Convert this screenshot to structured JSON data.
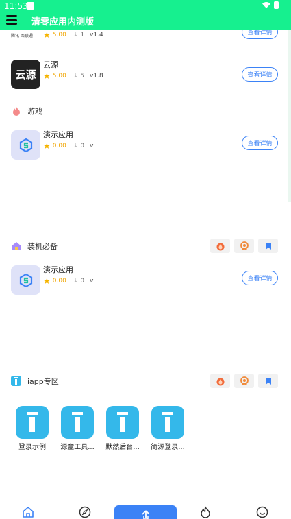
{
  "status": {
    "time": "11:53"
  },
  "header": {
    "title": "清零应用内测版"
  },
  "apps_top": [
    {
      "name": "云源",
      "rating": "5.00",
      "downloads": "5",
      "version": "v1.8",
      "icon_text": "云源",
      "button": "查看详情"
    }
  ],
  "partial_row": {
    "rating": "5.00",
    "downloads": "1",
    "version": "v1.4",
    "icon_text": "腾讯  西联通",
    "button": "查看详情"
  },
  "sections": {
    "games": {
      "title": "游戏",
      "app": {
        "name": "演示应用",
        "rating": "0.00",
        "downloads": "0",
        "version": "v",
        "button": "查看详情"
      }
    },
    "essentials": {
      "title": "装机必备",
      "app": {
        "name": "演示应用",
        "rating": "0.00",
        "downloads": "0",
        "version": "v",
        "button": "查看详情"
      }
    },
    "iapp": {
      "title": "iapp专区",
      "items": [
        {
          "label": "登录示例"
        },
        {
          "label": "源盒工具..."
        },
        {
          "label": "默然后台..."
        },
        {
          "label": "简源登录..."
        }
      ]
    }
  },
  "icons": {
    "section_actions": [
      "fire-icon",
      "award-icon",
      "bookmark-icon"
    ],
    "nav": [
      "home-icon",
      "compass-icon",
      "upload-icon",
      "flame-icon",
      "smile-icon"
    ]
  },
  "colors": {
    "header": "#16f08f",
    "accent": "#3b82f6",
    "star": "#f5b400",
    "iapp_tile": "#34b8ea"
  }
}
